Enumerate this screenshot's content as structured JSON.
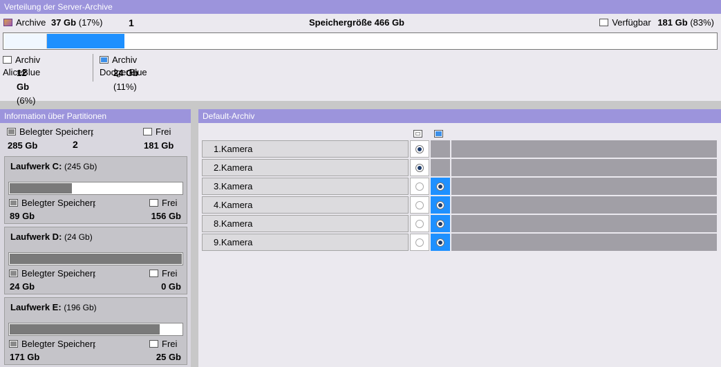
{
  "top": {
    "header": "Verteilung der Server-Archive",
    "archive_label": "Archive",
    "archive_size": "37 Gb",
    "archive_pct": "(17%)",
    "marker": "1",
    "total_label": "Speichergröße 466 Gb",
    "available_label": "Verfügbar",
    "available_size": "181 Gb",
    "available_pct": "(83%)",
    "bar_fill": {
      "alice": 0.06,
      "dodger": 0.11
    },
    "archives": [
      {
        "name": "Archiv AliceBlue",
        "size": "12 Gb",
        "pct": "(6%)",
        "color": "#f0f8ff"
      },
      {
        "name": "Archiv DodgerBlue",
        "size": "24 Gb",
        "pct": "(11%)",
        "color": "#1e90ff"
      }
    ]
  },
  "partitions": {
    "header": "Information über Partitionen",
    "used_label": "Belegter Speicherplatz",
    "free_label": "Frei",
    "used_total": "285 Gb",
    "free_total": "181 Gb",
    "marker": "2",
    "drives": [
      {
        "name": "Laufwerk C:",
        "capacity": "(245 Gb)",
        "used": "89 Gb",
        "free": "156 Gb",
        "used_fraction": 0.36
      },
      {
        "name": "Laufwerk D:",
        "capacity": "(24 Gb)",
        "used": "24 Gb",
        "free": "0 Gb",
        "used_fraction": 1.0
      },
      {
        "name": "Laufwerk E:",
        "capacity": "(196 Gb)",
        "used": "171 Gb",
        "free": "25 Gb",
        "used_fraction": 0.87
      }
    ]
  },
  "default_archive": {
    "header": "Default-Archiv",
    "cameras": [
      {
        "name": "1.Kamera",
        "archive": "alice"
      },
      {
        "name": "2.Kamera",
        "archive": "alice"
      },
      {
        "name": "3.Kamera",
        "archive": "dodger"
      },
      {
        "name": "4.Kamera",
        "archive": "dodger"
      },
      {
        "name": "8.Kamera",
        "archive": "dodger"
      },
      {
        "name": "9.Kamera",
        "archive": "dodger"
      }
    ]
  }
}
